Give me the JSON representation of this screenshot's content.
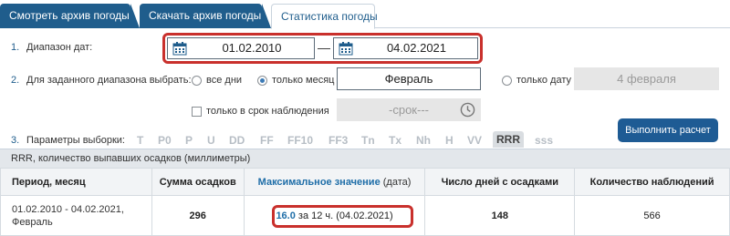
{
  "tabs": [
    {
      "label": "Смотреть архив погоды"
    },
    {
      "label": "Скачать архив погоды"
    },
    {
      "label": "Статистика погоды"
    }
  ],
  "form": {
    "step1": {
      "num": "1.",
      "label": "Диапазон дат:",
      "date_from": "01.02.2010",
      "dash": "—",
      "date_to": "04.02.2021"
    },
    "step2": {
      "num": "2.",
      "label": "Для заданного диапазона выбрать:",
      "opt_all": "все дни",
      "opt_month": "только месяц",
      "month_value": "Февраль",
      "opt_date": "только дату",
      "date_value": "4 февраля",
      "obs_check": "только в срок наблюдения",
      "term_placeholder": "-срок---"
    },
    "calc_button": "Выполнить расчет",
    "step3": {
      "num": "3.",
      "label": "Параметры выборки:",
      "params": [
        "T",
        "P0",
        "P",
        "U",
        "DD",
        "FF",
        "FF10",
        "FF3",
        "Tn",
        "Tx",
        "Nh",
        "H",
        "VV",
        "RRR",
        "sss"
      ],
      "selected": "RRR"
    }
  },
  "description": "RRR, количество выпавших осадков (миллиметры)",
  "table": {
    "headers": {
      "period": "Период, месяц",
      "sum": "Сумма осадков",
      "max_link": "Максимальное значение",
      "max_suffix": "(дата)",
      "days": "Число дней с осадками",
      "obs": "Количество наблюдений"
    },
    "row": {
      "period_line1": "01.02.2010 - 04.02.2021,",
      "period_line2": "Февраль",
      "sum": "296",
      "max_value": "16.0",
      "max_rest": "за 12 ч.  (04.02.2021)",
      "days": "148",
      "obs": "566"
    }
  },
  "colors": {
    "accent": "#1f5d8c",
    "highlight": "#c9302c",
    "button": "#1e5b94"
  }
}
